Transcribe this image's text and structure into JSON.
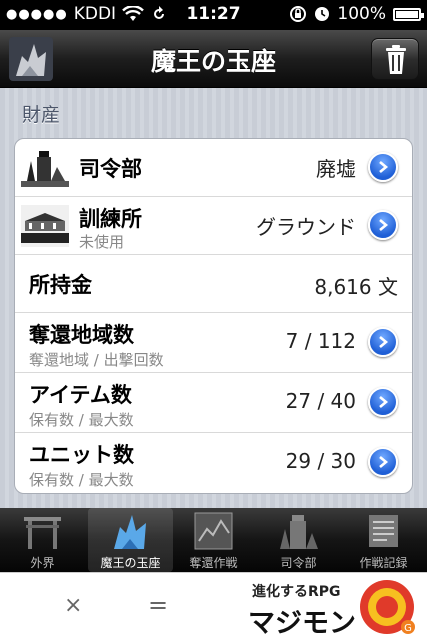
{
  "status_bar": {
    "carrier": "KDDI",
    "time": "11:27",
    "battery": "100%"
  },
  "navbar": {
    "title": "魔王の玉座",
    "trash_icon": "trash-icon"
  },
  "section": {
    "title": "財産"
  },
  "rows": [
    {
      "label": "司令部",
      "sub": "",
      "value": "廃墟",
      "has_disclosure": true,
      "icon": "fortress-image"
    },
    {
      "label": "訓練所",
      "sub": "未使用",
      "value": "グラウンド",
      "has_disclosure": true,
      "icon": "training-ground-image"
    },
    {
      "label": "所持金",
      "sub": "",
      "value": "8,616 文",
      "has_disclosure": false
    },
    {
      "label": "奪還地域数",
      "sub": "奪還地域 / 出撃回数",
      "value": "7 / 112",
      "has_disclosure": true
    },
    {
      "label": "アイテム数",
      "sub": "保有数 / 最大数",
      "value": "27 / 40",
      "has_disclosure": true
    },
    {
      "label": "ユニット数",
      "sub": "保有数 / 最大数",
      "value": "29 / 30",
      "has_disclosure": true
    }
  ],
  "tabs": [
    {
      "label": "外界",
      "active": false
    },
    {
      "label": "魔王の玉座",
      "active": true
    },
    {
      "label": "奪還作戦",
      "active": false
    },
    {
      "label": "司令部",
      "active": false
    },
    {
      "label": "作戦記録",
      "active": false
    }
  ],
  "ad": {
    "close_symbol": "×",
    "equals_symbol": "=",
    "tagline": "進化するRPG",
    "game_name": "マジモン"
  },
  "colors": {
    "accent_blue": "#1f5fd6",
    "nav_dark": "#1e1e1e",
    "background": "#d1d6de"
  }
}
